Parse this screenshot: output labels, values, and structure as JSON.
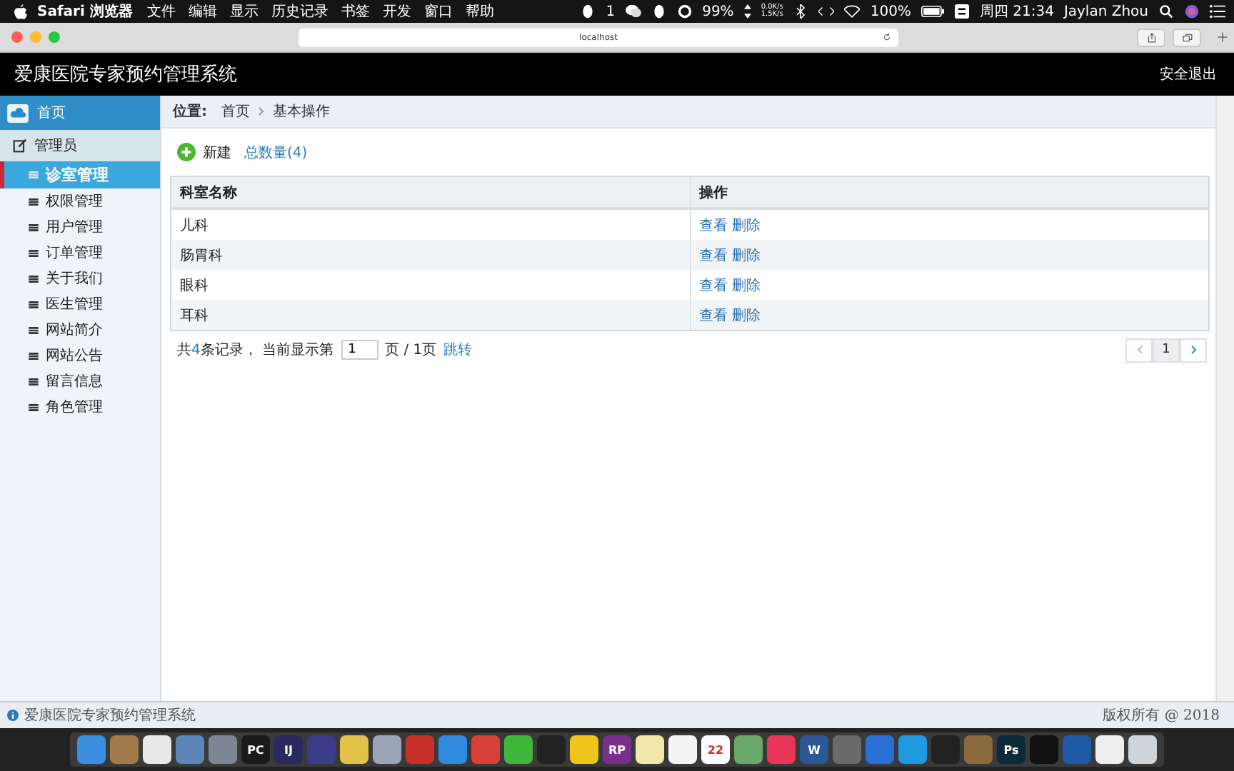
{
  "menubar": {
    "app": "Safari 浏览器",
    "menus": [
      "文件",
      "编辑",
      "显示",
      "历史记录",
      "书签",
      "开发",
      "窗口",
      "帮助"
    ],
    "qq_count": "1",
    "cpu": "99%",
    "net_up": "0.0K/s",
    "net_down": "1.5K/s",
    "battery": "100%",
    "clock": "周四 21:34",
    "user": "Jaylan Zhou"
  },
  "browser": {
    "address": "localhost"
  },
  "app": {
    "title": "爱康医院专家预约管理系统",
    "logout": "安全退出"
  },
  "sidebar": {
    "home": "首页",
    "group": "管理员",
    "items": [
      {
        "label": "诊室管理",
        "selected": true
      },
      {
        "label": "权限管理",
        "selected": false
      },
      {
        "label": "用户管理",
        "selected": false
      },
      {
        "label": "订单管理",
        "selected": false
      },
      {
        "label": "关于我们",
        "selected": false
      },
      {
        "label": "医生管理",
        "selected": false
      },
      {
        "label": "网站简介",
        "selected": false
      },
      {
        "label": "网站公告",
        "selected": false
      },
      {
        "label": "留言信息",
        "selected": false
      },
      {
        "label": "角色管理",
        "selected": false
      }
    ]
  },
  "breadcrumb": {
    "label": "位置:",
    "items": [
      "首页",
      "基本操作"
    ]
  },
  "toolbar": {
    "new": "新建",
    "count": "总数量(4)"
  },
  "table": {
    "columns": [
      "科室名称",
      "操作"
    ],
    "rows": [
      {
        "name": "儿科",
        "actions": [
          "查看",
          "删除"
        ]
      },
      {
        "name": "肠胃科",
        "actions": [
          "查看",
          "删除"
        ]
      },
      {
        "name": "眼科",
        "actions": [
          "查看",
          "删除"
        ]
      },
      {
        "name": "耳科",
        "actions": [
          "查看",
          "删除"
        ]
      }
    ]
  },
  "pager": {
    "before": "共",
    "total": "4",
    "middle": "条记录，  当前显示第",
    "page": "1",
    "after": "页 / 1页",
    "jump": "跳转",
    "current": "1"
  },
  "footer": {
    "left": "爱康医院专家预约管理系统",
    "right": "版权所有 @ 2018"
  },
  "dock": [
    {
      "color": "#3b8fe0"
    },
    {
      "color": "#a07a48"
    },
    {
      "color": "#e8e8e8"
    },
    {
      "color": "#5c86b8"
    },
    {
      "color": "#7c8694"
    },
    {
      "color": "#1b1b1b",
      "label": "PC"
    },
    {
      "color": "#2a2a60",
      "label": "IJ"
    },
    {
      "color": "#3b3b8a"
    },
    {
      "color": "#e3c04a"
    },
    {
      "color": "#9aa6b8"
    },
    {
      "color": "#c8302a"
    },
    {
      "color": "#2f8be0"
    },
    {
      "color": "#d9403a"
    },
    {
      "color": "#3fb83a"
    },
    {
      "color": "#222222"
    },
    {
      "color": "#f0c419"
    },
    {
      "color": "#7a2e8e",
      "label": "RP"
    },
    {
      "color": "#f1e7a8"
    },
    {
      "color": "#f4f4f4"
    },
    {
      "color": "#ffffff",
      "label": "22"
    },
    {
      "color": "#6aa86a"
    },
    {
      "color": "#e8365a"
    },
    {
      "color": "#2b5797",
      "label": "W"
    },
    {
      "color": "#6a6a6a"
    },
    {
      "color": "#2a6fd6"
    },
    {
      "color": "#1f9ae0"
    },
    {
      "color": "#222222"
    },
    {
      "color": "#8a6a3a"
    },
    {
      "color": "#0d2a3a",
      "label": "Ps"
    },
    {
      "color": "#111111"
    },
    {
      "color": "#1e5aa8"
    },
    {
      "color": "#eeeeee"
    },
    {
      "color": "#cfd4d8"
    }
  ]
}
